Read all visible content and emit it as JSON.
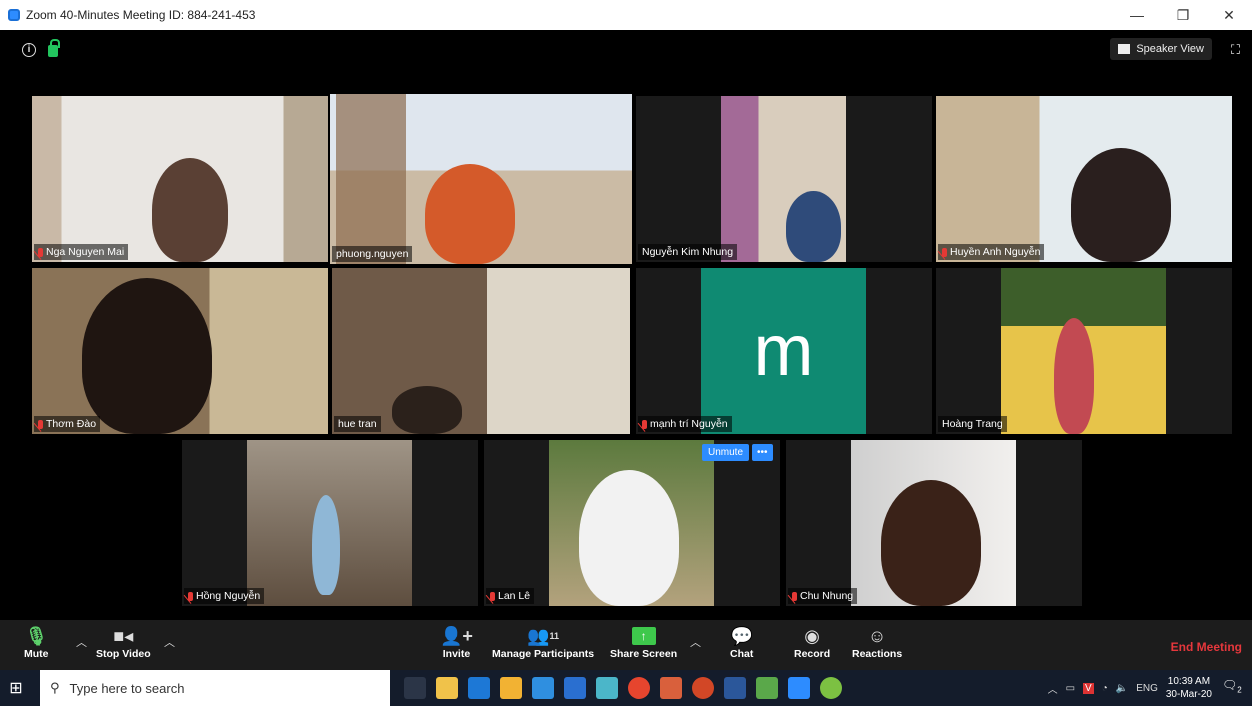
{
  "window": {
    "title": "Zoom 40-Minutes Meeting ID: 884-241-453",
    "min": "—",
    "max": "❐",
    "close": "✕"
  },
  "meeting": {
    "speaker_view_label": "Speaker View"
  },
  "participants": [
    {
      "name": "Nga Nguyen Mai",
      "muted": true
    },
    {
      "name": "phuong.nguyen",
      "muted": false
    },
    {
      "name": "Nguyễn Kim Nhung",
      "muted": false
    },
    {
      "name": "Huyền Anh Nguyễn",
      "muted": true
    },
    {
      "name": "Thơm Đào",
      "muted": true
    },
    {
      "name": "hue tran",
      "muted": false
    },
    {
      "name": "mạnh trí Nguyễn",
      "muted": true,
      "avatar_letter": "m"
    },
    {
      "name": "Hoàng Trang",
      "muted": false
    },
    {
      "name": "Hồng Nguyễn",
      "muted": true
    },
    {
      "name": "Lan Lê",
      "muted": true
    },
    {
      "name": "Chu Nhung",
      "muted": true
    }
  ],
  "unmute_overlay": {
    "label": "Unmute",
    "more": "•••"
  },
  "toolbar": {
    "mute": "Mute",
    "stop_video": "Stop Video",
    "invite": "Invite",
    "manage_participants": "Manage Participants",
    "participant_count": "11",
    "share_screen": "Share Screen",
    "chat": "Chat",
    "record": "Record",
    "reactions": "Reactions",
    "end_meeting": "End Meeting"
  },
  "taskbar": {
    "search_placeholder": "Type here to search",
    "lang": "ENG",
    "time": "10:39 AM",
    "date": "30-Mar-20",
    "notif_count": "2"
  }
}
